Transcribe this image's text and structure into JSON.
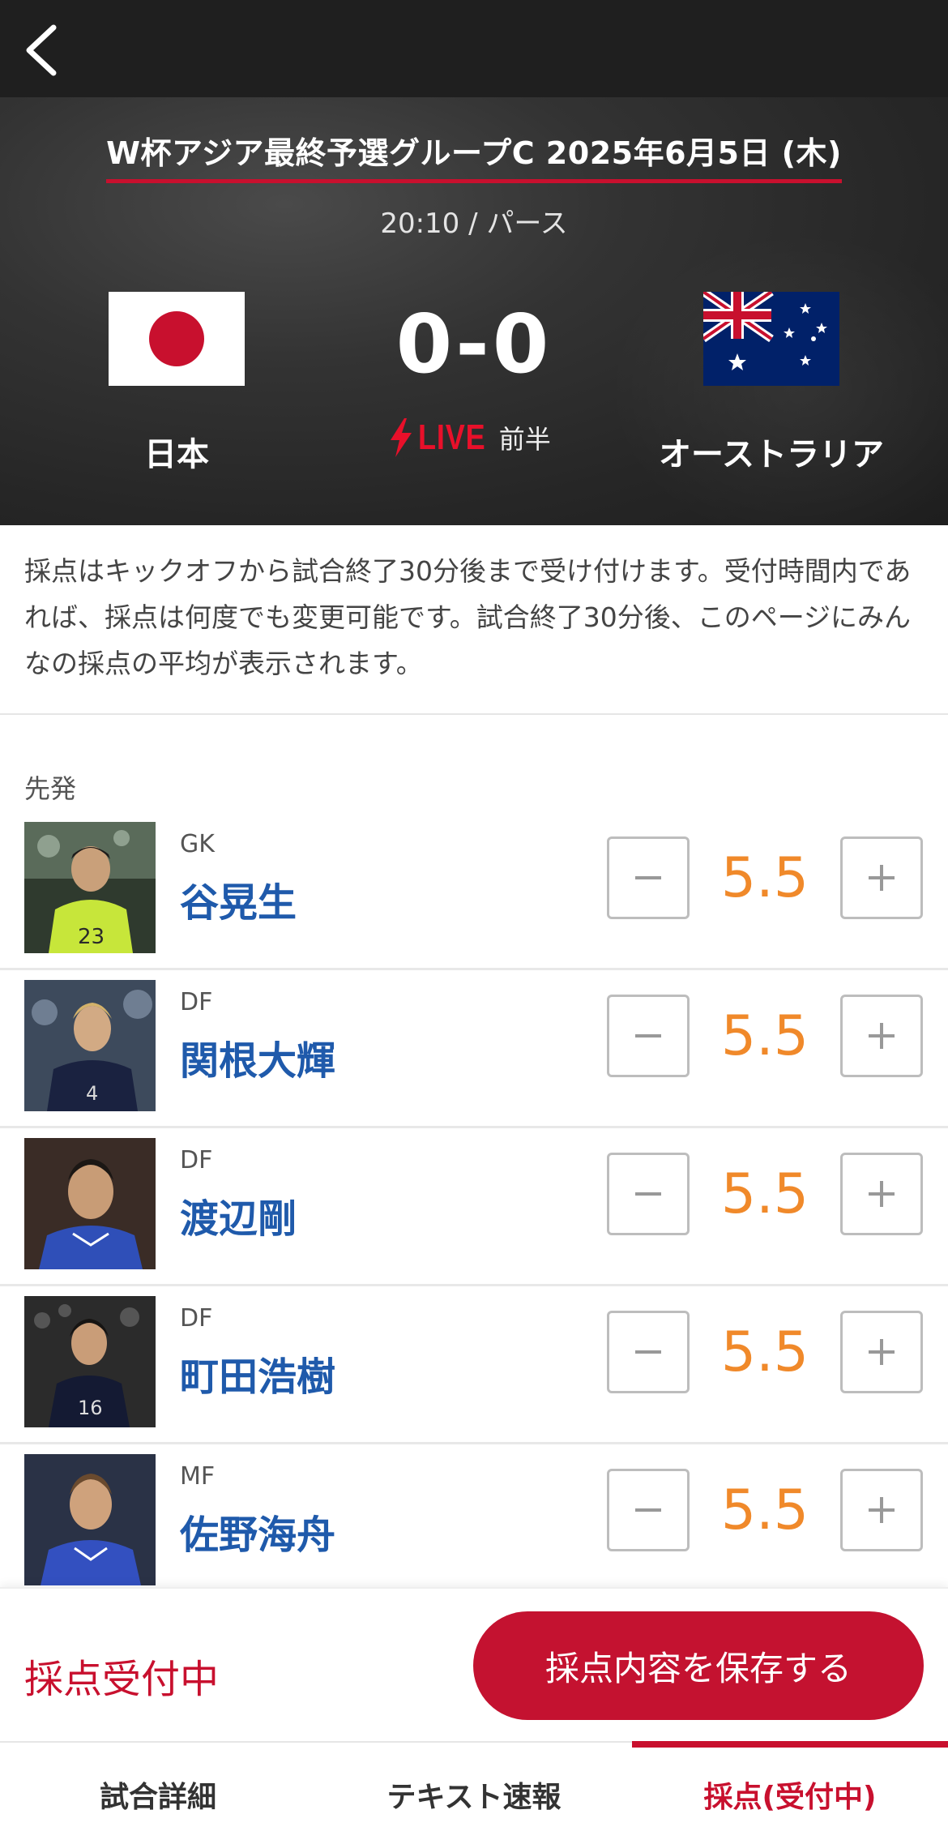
{
  "header": {
    "back_icon": "chevron-left-icon"
  },
  "match": {
    "competition": "W杯アジア最終予選グループC 2025年6月5日 (木)",
    "kickoff": "20:10 / パース",
    "home_team": "日本",
    "away_team": "オーストラリア",
    "score": "0-0",
    "live_label": "LIVE",
    "period": "前半",
    "colors": {
      "accent_red": "#c8102e",
      "live_red": "#e8102a"
    }
  },
  "notice": "採点はキックオフから試合終了30分後まで受け付けます。受付時間内であれば、採点は何度でも変更可能です。試合終了30分後、このページにみんなの採点の平均が表示されます。",
  "section_label": "先発",
  "players": [
    {
      "position": "GK",
      "name": "谷晃生",
      "score": "5.5"
    },
    {
      "position": "DF",
      "name": "関根大輝",
      "score": "5.5"
    },
    {
      "position": "DF",
      "name": "渡辺剛",
      "score": "5.5"
    },
    {
      "position": "DF",
      "name": "町田浩樹",
      "score": "5.5"
    },
    {
      "position": "MF",
      "name": "佐野海舟",
      "score": "5.5"
    }
  ],
  "footer": {
    "status": "採点受付中",
    "save_label": "採点内容を保存する"
  },
  "tabs": [
    {
      "label": "試合詳細"
    },
    {
      "label": "テキスト速報"
    },
    {
      "label": "採点(受付中)",
      "active": true
    }
  ],
  "score_color": "#f0892a",
  "name_color": "#1f5aab"
}
